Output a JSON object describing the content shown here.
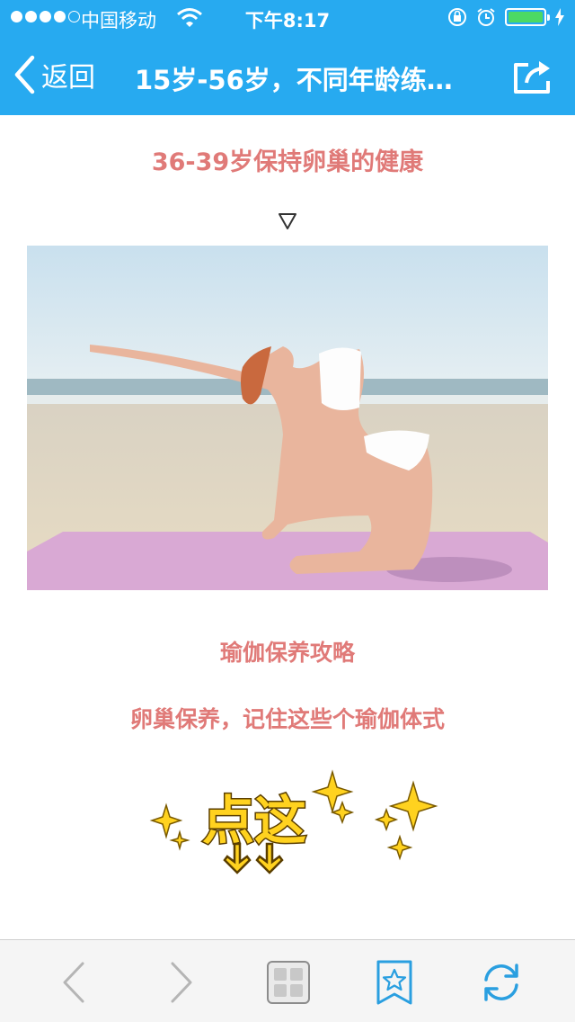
{
  "status_bar": {
    "carrier": "中国移动",
    "time": "下午8:17",
    "battery_percent": 100
  },
  "nav": {
    "back_label": "返回",
    "title": "15岁-56岁，不同年龄练…"
  },
  "article": {
    "section_heading": "36-39岁保持卵巢的健康",
    "down_marker": "▽",
    "subheading": "瑜伽保养攻略",
    "subheading2": "卵巢保养，记住这些个瑜伽体式",
    "sticker_text": "点这"
  },
  "colors": {
    "nav_blue": "#27aaf0",
    "accent_pink": "#e07a78",
    "sticker_yellow": "#ffd21f",
    "toolbar_blue": "#2a9fe0"
  },
  "icons": {
    "back": "chevron-left-icon",
    "share": "share-icon",
    "toolbar_back": "chevron-left-icon",
    "toolbar_forward": "chevron-right-icon",
    "toolbar_tabs": "tabs-icon",
    "toolbar_favorites": "star-bookmark-icon",
    "toolbar_refresh": "refresh-icon"
  }
}
